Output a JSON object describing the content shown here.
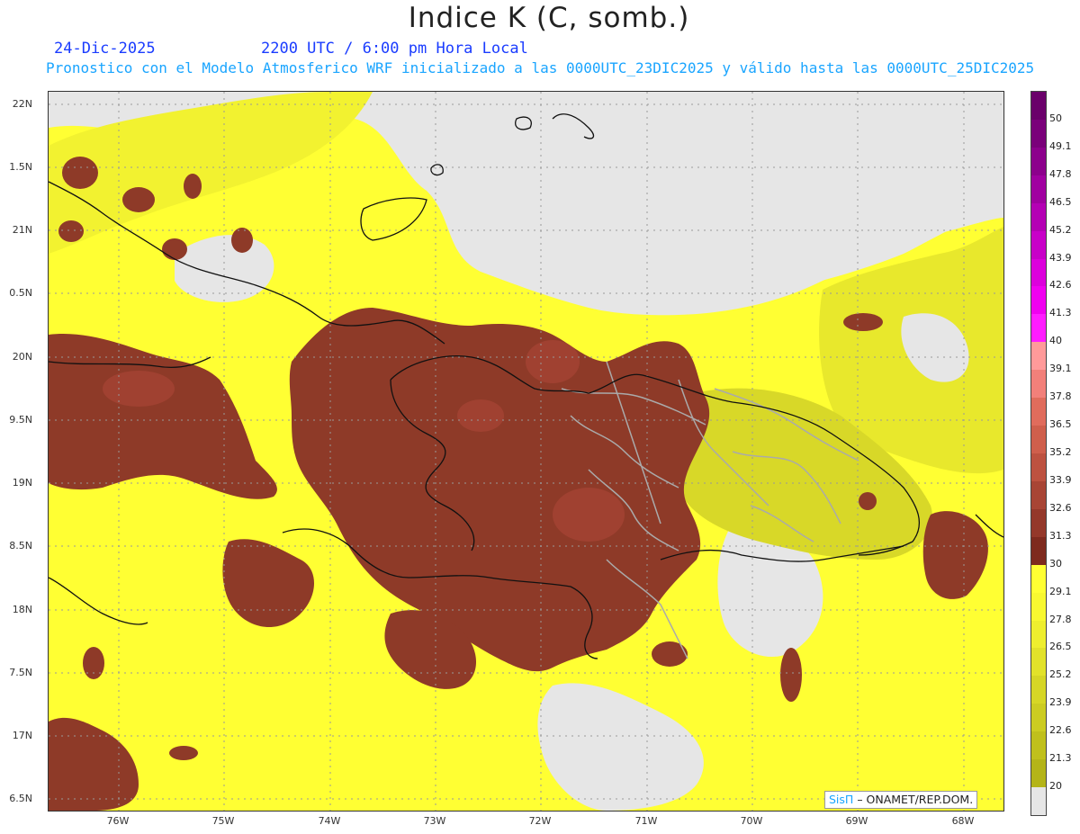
{
  "header": {
    "title": "Indice K (C, somb.)",
    "date": "24-Dic-2025",
    "time": "2200 UTC / 6:00 pm Hora Local",
    "subtitle": "Pronostico con el Modelo Atmosferico WRF inicializado a las 0000UTC_23DIC2025 y válido hasta las  0000UTC_25DIC2025"
  },
  "map": {
    "lat_labels": [
      "22N",
      "1.5N",
      "21N",
      "0.5N",
      "20N",
      "9.5N",
      "19N",
      "8.5N",
      "18N",
      "7.5N",
      "17N",
      "6.5N"
    ],
    "lon_labels": [
      "76W",
      "75W",
      "74W",
      "73W",
      "72W",
      "71W",
      "70W",
      "69W",
      "68W"
    ]
  },
  "colorbar": {
    "labels": [
      "50",
      "49.1",
      "47.8",
      "46.5",
      "45.2",
      "43.9",
      "42.6",
      "41.3",
      "40",
      "39.1",
      "37.8",
      "36.5",
      "35.2",
      "33.9",
      "32.6",
      "31.3",
      "30",
      "29.1",
      "27.8",
      "26.5",
      "25.2",
      "23.9",
      "22.6",
      "21.3",
      "20"
    ],
    "colors": [
      "#6a006a",
      "#7a007a",
      "#8c008c",
      "#a000a0",
      "#b400b4",
      "#c800c8",
      "#dc00dc",
      "#f000f0",
      "#ff1cff",
      "#ff9a9a",
      "#f2807a",
      "#e06c5c",
      "#cf5f4c",
      "#bd5240",
      "#a84535",
      "#94382a",
      "#7e2a1e",
      "#ffff33",
      "#f8f830",
      "#eeee2e",
      "#e2e22a",
      "#d6d626",
      "#cccc22",
      "#c0c01c",
      "#b4b418",
      "#e6e6e6"
    ]
  },
  "credit": {
    "logo": "SisΠ",
    "org": "– ONAMET/REP.DOM."
  }
}
